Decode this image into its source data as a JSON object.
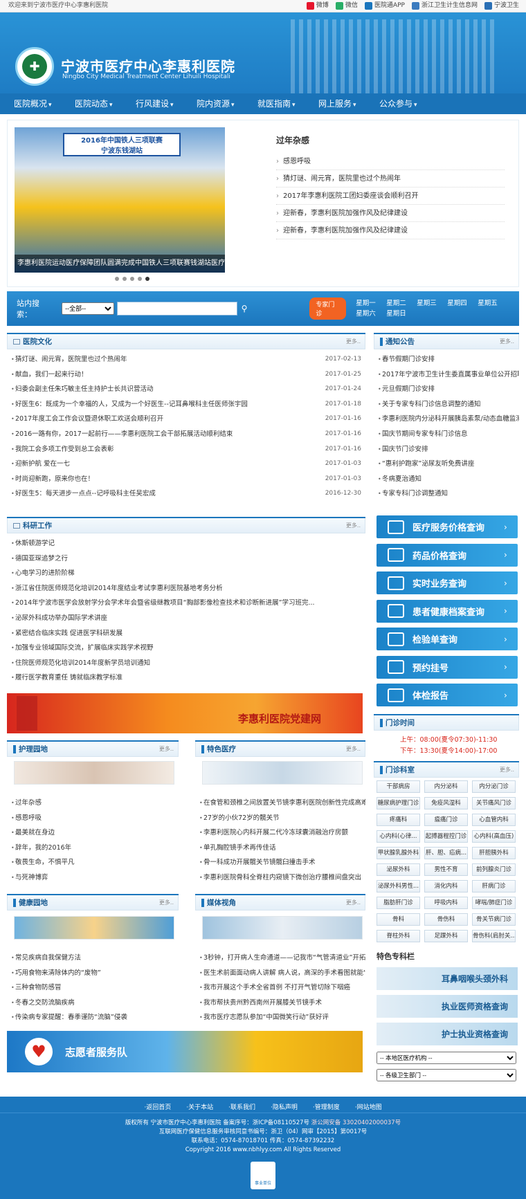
{
  "top": {
    "welcome": "欢迎来到宁波市医疗中心李惠利医院",
    "links": [
      {
        "label": "微博",
        "icon": "weibo-icon",
        "color": "#e6162d"
      },
      {
        "label": "微信",
        "icon": "wechat-icon",
        "color": "#2aae67"
      },
      {
        "label": "医院通APP",
        "icon": "app-icon",
        "color": "#1b76bd"
      },
      {
        "label": "浙江卫生计生信息网",
        "icon": "info-icon",
        "color": "#3b7bbf"
      },
      {
        "label": "宁波卫生",
        "icon": "ningbo-health-icon",
        "color": "#2a6fb5"
      }
    ]
  },
  "header": {
    "name_cn": "宁波市医疗中心李惠利医院",
    "name_en": "Ningbo City Medical Treatment Center Lihuili Hospitali",
    "logo_icon": "red-cross-icon"
  },
  "nav": [
    "医院概况",
    "医院动态",
    "行风建设",
    "院内资源",
    "就医指南",
    "网上服务",
    "公众参与"
  ],
  "banner": {
    "sign_line1": "2016年中国铁人三项联赛",
    "sign_line2": "宁波东钱湖站",
    "caption": "李惠利医院运动医疗保障团队圆满完成中国铁人三项联赛钱湖站医疗保...",
    "news_title": "过年杂感",
    "news": [
      "感恩呼吸",
      "猜灯谜、闹元宵，医院里也过个热闹年",
      "2017年李惠利医院工团妇委座谈会顺利召开",
      "迎新春，李惠利医院加强作风及纪律建设",
      "迎新春，李惠利医院加强作风及纪律建设"
    ]
  },
  "search": {
    "label": "站内搜索：",
    "option": "--全部--",
    "expert": "专家门诊",
    "days": [
      "星期一",
      "星期二",
      "星期三",
      "星期四",
      "星期五",
      "星期六",
      "星期日"
    ]
  },
  "culture": {
    "title": "医院文化",
    "more": "更多..",
    "items": [
      {
        "t": "猜灯谜、闹元宵，医院里也过个热闹年",
        "d": "2017-02-13"
      },
      {
        "t": "献血，我们一起来行动！",
        "d": "2017-01-25"
      },
      {
        "t": "妇委会副主任朱巧敏主任主持护士长共识营活动",
        "d": "2017-01-24"
      },
      {
        "t": "好医生6：既成为一个幸福的人，又成为一个好医生--记耳鼻喉科主任医师张宇园",
        "d": "2017-01-18"
      },
      {
        "t": "2017年度工会工作会议暨退休职工欢送会顺利召开",
        "d": "2017-01-16"
      },
      {
        "t": "2016一路有你，2017一起前行——李惠利医院工会干部拓展活动顺利结束",
        "d": "2017-01-16"
      },
      {
        "t": "我院工会多项工作受到总工会表彰",
        "d": "2017-01-16"
      },
      {
        "t": "迎新护航 爱在一七",
        "d": "2017-01-03"
      },
      {
        "t": "时尚迎新跑，原来你也在！",
        "d": "2017-01-03"
      },
      {
        "t": "好医生5：每天进步一点点--记呼吸科主任吴宏成",
        "d": "2016-12-30"
      }
    ]
  },
  "notice": {
    "title": "通知公告",
    "more": "更多..",
    "items": [
      "春节假期门诊安排",
      "2017年宁波市卫生计生委直属事业单位公开招聘...",
      "元旦假期门诊安排",
      "关于专家专科门诊信息调整的通知",
      "李惠利医院内分泌科开展胰岛素泵/动态血糖监测...",
      "国庆节期间专家专科门诊信息",
      "国庆节门诊安排",
      "“惠利护跑家”泌尿友听免费讲座",
      "冬病夏治通知",
      "专家专科门诊调整通知"
    ]
  },
  "research": {
    "title": "科研工作",
    "more": "更多..",
    "items": [
      "休斯顿游学记",
      "德国亚琛追梦之行",
      "心电学习的进阶阶梯",
      "浙江省住院医师规范化培训2014年度结业考试李惠利医院基地考务分析",
      "2014年宁波市医学会放射学分会学术年会暨省级继教项目“胸部影像检查技术和诊断新进展”学习班完...",
      "泌尿外科成功举办国际学术讲座",
      "紧密结合临床实践 促进医学科研发展",
      "加强专业领域国际交流，扩展临床实践学术视野",
      "住院医师规范化培训2014年度新学员培训通知",
      "履行医学教育重任 铸就临床教学标准"
    ]
  },
  "services": [
    {
      "label": "医疗服务价格查询",
      "icon": "price-icon"
    },
    {
      "label": "药品价格查询",
      "icon": "pill-icon"
    },
    {
      "label": "实时业务查询",
      "icon": "bed-icon"
    },
    {
      "label": "患者健康档案查询",
      "icon": "record-icon"
    },
    {
      "label": "检验单查询",
      "icon": "magnifier-icon"
    },
    {
      "label": "预约挂号",
      "icon": "globe-icon"
    },
    {
      "label": "体检报告",
      "icon": "report-icon"
    }
  ],
  "party": {
    "text": "李惠利医院党建网"
  },
  "hours": {
    "title": "门诊时间",
    "am": "上午：08:00(夏令07:30)-11:30",
    "pm": "下午：13:30(夏令14:00)-17:00"
  },
  "clinics": {
    "title": "门诊科室",
    "more": "更多..",
    "items": [
      "干部病房",
      "内分泌科",
      "内分泌门诊",
      "糖尿病护理门诊",
      "免疫风湿科",
      "关节痛风门诊",
      "疼痛科",
      "瘟痛门诊",
      "心血管内科",
      "心内科(心律...",
      "起搏器程控门诊",
      "心内科(高血压)",
      "甲状腺乳腺外科",
      "肝、胆、疝病...",
      "肝胆胰外科",
      "泌尿外科",
      "男性不育",
      "前列腺炎门诊",
      "泌尿外科男性...",
      "消化内科",
      "肝病门诊",
      "脂肪肝门诊",
      "呼吸内科",
      "哮喘/肺症门诊",
      "骨科",
      "骨伤科",
      "骨关节病门诊",
      "脊柱外科",
      "足踝外科",
      "骨伤科(肩肘关..."
    ]
  },
  "nursing": {
    "title": "护理园地",
    "more": "更多..",
    "items": [
      "过年杂感",
      "感恩呼吸",
      "最美就在身边",
      "辞年，我的2016年",
      "敬畏生命，不惧平凡",
      "与死神博弈"
    ]
  },
  "special": {
    "title": "特色医疗",
    "more": "更多..",
    "items": [
      "在食管和颈椎之间放置关节镜李惠利医院创新性完成高难度...",
      "27岁的小伙72岁的髋关节",
      "李惠利医院心内科开展二代冷冻球囊消融治疗房颤",
      "单孔胸腔镜手术再传佳话",
      "骨一科成功开展髋关节镜髋臼撞击手术",
      "李惠利医院骨科全脊柱内窥镜下微创治疗腰椎间盘突出"
    ]
  },
  "health": {
    "title": "健康园地",
    "more": "更多..",
    "items": [
      "常见疾病自我保健方法",
      "巧用食物来清除体内的“废物”",
      "三种食物防感冒",
      "冬春之交防流脑疾病",
      "传染病专家提醒：春季谨防“流脑”侵袭"
    ]
  },
  "media": {
    "title": "媒体视角",
    "more": "更多..",
    "items": [
      "3秒钟，打开病人生命通道——记我市“气管清道业”开拓...",
      "医生术前面面动病人讲解 病人说，高深的手术看图就能“...",
      "我市开展这个手术全省首例 不打开气管切除下咽癌",
      "我市帮扶贵州黔西南州开展膝关节镜手术",
      "我市医疗志愿队参加“中国微笑行动”获好评"
    ]
  },
  "specialties": {
    "title": "特色专科栏",
    "items": [
      "耳鼻咽喉头颈外科",
      "执业医师资格查询",
      "护士执业资格查询"
    ],
    "sel1": "-- 本地区医疗机构 --",
    "sel2": "-- 各级卫生部门 --"
  },
  "volunteer": {
    "text": "志愿者服务队"
  },
  "footer": {
    "links": [
      "·返回首页",
      "·关于本站",
      "·联系我们",
      "·隐私声明",
      "·管理制度",
      "·网站地图"
    ],
    "l1": "版权所有 宁波市医疗中心李惠利医院 备案序号：浙ICP备08110527号",
    "police": "浙公网安备 33020402000037号",
    "l2": "互联网医疗保健信息服务审核同意书编号：浙卫（04）网审【2015】第0017号",
    "l3": "联系电话：0574-87018701 传真：0574-87392232",
    "l4": "Copyright 2016 www.nbhlyy.com All Rights Reserved",
    "badge": "事业单位"
  }
}
